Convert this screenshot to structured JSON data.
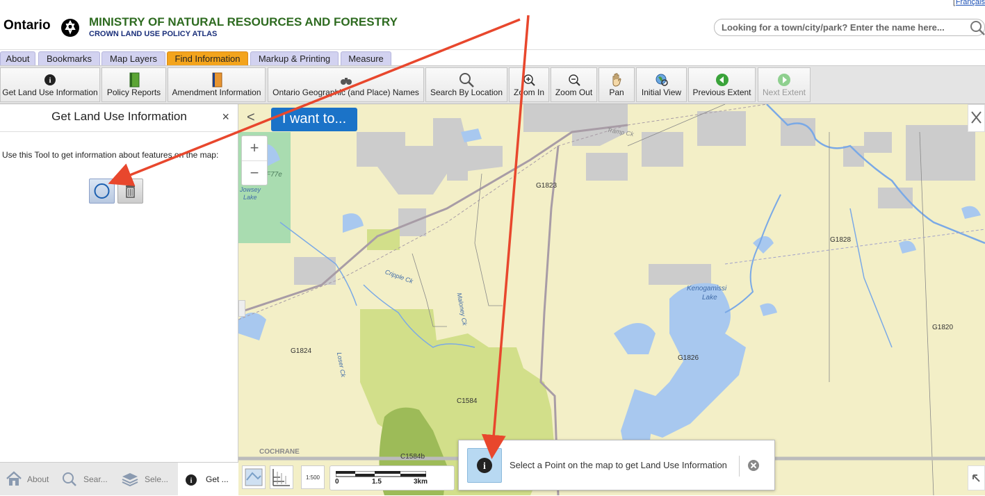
{
  "header": {
    "logo_text": "Ontario",
    "ministry": "MINISTRY OF NATURAL RESOURCES AND FORESTRY",
    "atlas": "CROWN LAND USE POLICY ATLAS",
    "lang_bracket": "[",
    "lang": "Français",
    "search_placeholder": "Looking for a town/city/park? Enter the name here..."
  },
  "tabs": [
    {
      "label": "About"
    },
    {
      "label": "Bookmarks"
    },
    {
      "label": "Map Layers"
    },
    {
      "label": "Find Information",
      "active": true
    },
    {
      "label": "Markup & Printing"
    },
    {
      "label": "Measure"
    }
  ],
  "toolbar": [
    {
      "label": "Get Land Use Information",
      "icon": "info-icon"
    },
    {
      "label": "Policy Reports",
      "icon": "green-book-icon"
    },
    {
      "label": "Amendment Information",
      "icon": "orange-book-icon"
    },
    {
      "label": "Ontario Geographic (and Place) Names",
      "icon": "binoculars-icon"
    },
    {
      "label": "Search By Location",
      "icon": "magnifier-icon"
    },
    {
      "label": "Zoom In",
      "icon": "zoom-in-icon"
    },
    {
      "label": "Zoom Out",
      "icon": "zoom-out-icon"
    },
    {
      "label": "Pan",
      "icon": "hand-icon"
    },
    {
      "label": "Initial View",
      "icon": "globe-icon"
    },
    {
      "label": "Previous Extent",
      "icon": "green-back-icon"
    },
    {
      "label": "Next Extent",
      "icon": "green-forward-icon",
      "disabled": true
    }
  ],
  "panel": {
    "title": "Get Land Use Information",
    "close": "×",
    "description": "Use this Tool to get information about features on the map:"
  },
  "bottom_tabs": [
    {
      "label": "About",
      "icon": "home-icon"
    },
    {
      "label": "Sear...",
      "icon": "search-icon"
    },
    {
      "label": "Sele...",
      "icon": "layers-icon"
    },
    {
      "label": "Get ...",
      "icon": "info-icon",
      "active": true
    }
  ],
  "map": {
    "iwant": "I want to...",
    "collapse": "<",
    "zoom_in": "+",
    "zoom_out": "−",
    "labels": {
      "g1823": "G1823",
      "g1828": "G1828",
      "g1820": "G1820",
      "g1824": "G1824",
      "g1826": "G1826",
      "c1584": "C1584",
      "c1584b": "C1584b",
      "f77e": "F77e",
      "jowsey": "Jowsey",
      "jowsey_lake": "Lake",
      "kenogamissi": "Kenogamissi",
      "kenogamissi_lake": "Lake",
      "cochrane": "COCHRANE",
      "cripple": "Cripple Ck",
      "maloney": "Maloney Ck",
      "loser": "Loser Ck",
      "tramp": "Tramp Ck"
    },
    "scale": {
      "zero": "0",
      "mid": "1.5",
      "end": "3km"
    },
    "scale_ratio_label": "1:500"
  },
  "toast": {
    "text": "Select a Point on the map to get Land Use Information"
  },
  "colors": {
    "active_tab": "#f3a41c",
    "tab": "#d2d2f0",
    "map_bg": "#f3efc7",
    "water": "#a8c8ef",
    "park_light": "#d2df8a",
    "park_dark": "#9dbb58",
    "grey_area": "#cccccc",
    "arrow": "#e8472d",
    "iwant": "#1b73c8"
  }
}
